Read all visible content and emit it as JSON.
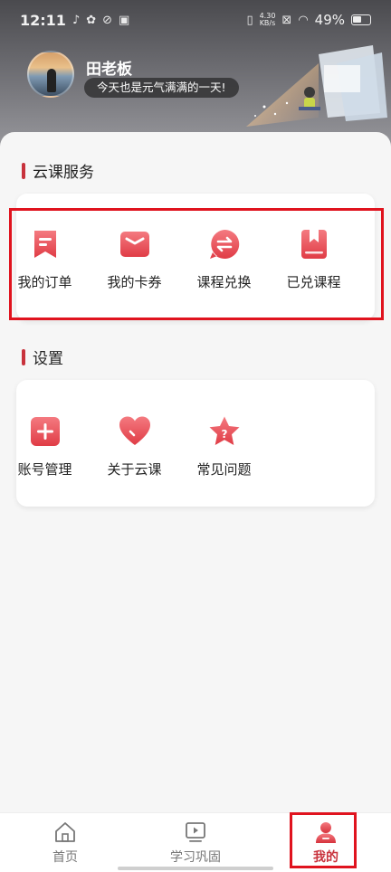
{
  "status_bar": {
    "time": "12:11",
    "net_speed_value": "4.30",
    "net_speed_unit": "KB/s",
    "battery": "49%"
  },
  "profile": {
    "name": "田老板",
    "motto": "今天也是元气满满的一天!"
  },
  "services": {
    "title": "云课服务",
    "items": [
      {
        "label": "我的订单",
        "icon": "bookmark-order-icon"
      },
      {
        "label": "我的卡券",
        "icon": "coupon-card-icon"
      },
      {
        "label": "课程兑换",
        "icon": "exchange-icon"
      },
      {
        "label": "已兑课程",
        "icon": "redeemed-book-icon"
      }
    ]
  },
  "settings": {
    "title": "设置",
    "items": [
      {
        "label": "账号管理",
        "icon": "plus-square-icon"
      },
      {
        "label": "关于云课",
        "icon": "heart-icon"
      },
      {
        "label": "常见问题",
        "icon": "question-star-icon"
      }
    ]
  },
  "bottom_nav": {
    "items": [
      {
        "label": "首页",
        "icon": "home-icon"
      },
      {
        "label": "学习巩固",
        "icon": "play-screen-icon"
      },
      {
        "label": "我的",
        "icon": "person-icon"
      }
    ]
  },
  "colors": {
    "accent": "#c8323c",
    "icon_gradient_top": "#f47a80",
    "icon_gradient_bottom": "#e03c46",
    "highlight": "#e0131e"
  }
}
